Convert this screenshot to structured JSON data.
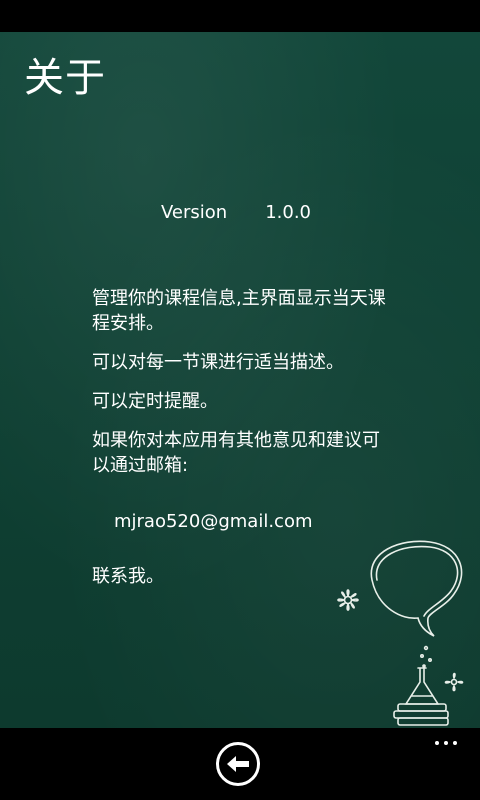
{
  "page": {
    "title": "关于"
  },
  "about": {
    "version_label": "Version",
    "version_value": "1.0.0",
    "lines": [
      "管理你的课程信息,主界面显示当天课程安排。",
      "可以对每一节课进行适当描述。",
      "可以定时提醒。",
      "如果你对本应用有其他意见和建议可以通过邮箱:"
    ],
    "email": "mjrao520@gmail.com",
    "contact": "联系我。"
  },
  "app_bar": {
    "back_icon": "back-arrow-icon",
    "more_icon": "ellipsis-icon"
  },
  "colors": {
    "background": "#0f4134",
    "bars": "#000000",
    "text": "#ffffff"
  }
}
